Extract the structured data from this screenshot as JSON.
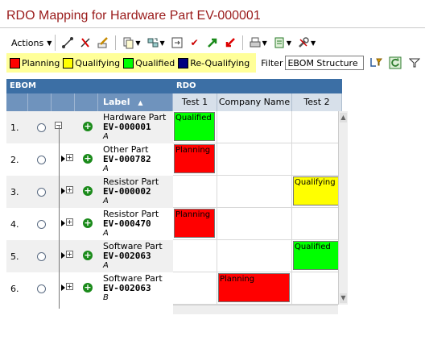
{
  "title": "RDO Mapping for Hardware Part EV-000001",
  "toolbar": {
    "actions_label": "Actions",
    "icons": [
      "connect-icon",
      "disconnect-icon",
      "edit-icon",
      "copy-icon",
      "sync-icon",
      "compare-icon",
      "approve-icon",
      "promote-icon",
      "demote-icon",
      "print-icon",
      "export-icon",
      "tools-icon"
    ]
  },
  "legend": [
    {
      "label": "Planning",
      "color": "#ff0000"
    },
    {
      "label": "Qualifying",
      "color": "#ffff00"
    },
    {
      "label": "Qualified",
      "color": "#00ff00"
    },
    {
      "label": "Re-Qualifying",
      "color": "#000080"
    }
  ],
  "filter": {
    "label": "Filter",
    "value": "EBOM Structure"
  },
  "grid": {
    "ebom_header": "EBOM",
    "rdo_header": "RDO",
    "label_header": "Label",
    "rdo_columns": [
      "Test 1",
      "Company Name",
      "Test 2"
    ],
    "rows": [
      {
        "num": "1.",
        "type": "Hardware Part",
        "name": "EV-000001",
        "rev": "A",
        "tree": "collapse",
        "cells": [
          "Qualified",
          "",
          ""
        ]
      },
      {
        "num": "2.",
        "type": "Other Part",
        "name": "EV-000782",
        "rev": "A",
        "tree": "expand",
        "cells": [
          "Planning",
          "",
          ""
        ]
      },
      {
        "num": "3.",
        "type": "Resistor Part",
        "name": "EV-000002",
        "rev": "A",
        "tree": "expand",
        "cells": [
          "",
          "",
          "Qualifying"
        ]
      },
      {
        "num": "4.",
        "type": "Resistor Part",
        "name": "EV-000470",
        "rev": "A",
        "tree": "expand",
        "cells": [
          "Planning",
          "",
          ""
        ]
      },
      {
        "num": "5.",
        "type": "Software Part",
        "name": "EV-002063",
        "rev": "A",
        "tree": "expand",
        "cells": [
          "",
          "",
          "Qualified"
        ]
      },
      {
        "num": "6.",
        "type": "Software Part",
        "name": "EV-002063",
        "rev": "B",
        "tree": "expand",
        "cells": [
          "",
          "Planning",
          ""
        ]
      }
    ]
  },
  "status_colors": {
    "Qualified": "#00ff00",
    "Planning": "#ff0000",
    "Qualifying": "#ffff00",
    "Re-Qualifying": "#000080"
  }
}
